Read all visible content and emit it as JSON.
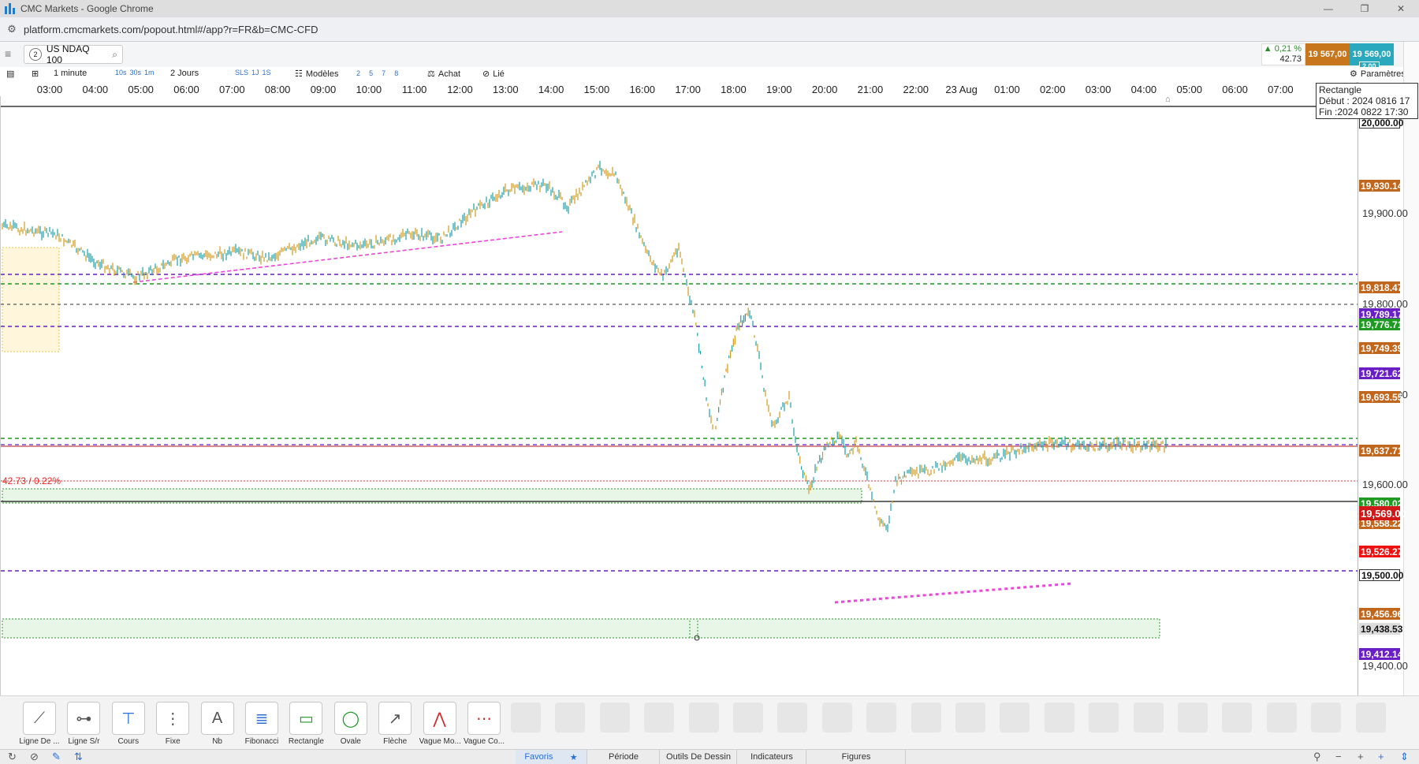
{
  "browser": {
    "window_title": "CMC Markets - Google Chrome",
    "url": "platform.cmcmarkets.com/popout.html#/app?r=FR&b=CMC-CFD",
    "controls": [
      "—",
      "❐",
      "✕"
    ]
  },
  "instrument": {
    "number": "2",
    "name": "US NDAQ 100"
  },
  "quote": {
    "change_pct": "▲ 0,21 %",
    "change_pts": "42.73",
    "bid": "19 567,00",
    "ask": "19 569,00",
    "spread": "2.00",
    "up_color": "#2a8a2a",
    "bid_color": "#c8761c",
    "ask_color": "#2aa8bd"
  },
  "toolbar": {
    "interval": "1 minute",
    "quick_intervals": [
      "10s",
      "30s",
      "1m"
    ],
    "range": "2 Jours",
    "chart_types": [
      "SLS",
      "1J",
      "1S"
    ],
    "models": "Modèles",
    "tick_modes": [
      "2",
      "5",
      "7",
      "8"
    ],
    "side": "Achat",
    "link": "Lié",
    "settings": "Paramètres"
  },
  "time_axis": [
    "03:00",
    "04:00",
    "05:00",
    "06:00",
    "07:00",
    "08:00",
    "09:00",
    "10:00",
    "11:00",
    "12:00",
    "13:00",
    "14:00",
    "15:00",
    "16:00",
    "17:00",
    "18:00",
    "19:00",
    "20:00",
    "21:00",
    "22:00",
    "23 Aug",
    "01:00",
    "02:00",
    "03:00",
    "04:00",
    "05:00",
    "06:00",
    "07:00"
  ],
  "tooltip": {
    "title": "Rectangle",
    "start": "Début : 2024 0816 17",
    "end": "Fin :2024 0822 17:30"
  },
  "price_axis": {
    "ticks": [
      "19,900.00",
      "19,800.00",
      "19,700.00",
      "19,600.00",
      "19,400.00"
    ],
    "labels": [
      {
        "text": "20,000.00",
        "bg": "#ffffff",
        "fg": "#111111"
      },
      {
        "text": "19,930.14",
        "bg": "#c0661d",
        "fg": "#ffffff"
      },
      {
        "text": "19,818.47",
        "bg": "#c0661d",
        "fg": "#ffffff"
      },
      {
        "text": "19,789.17",
        "bg": "#6a1fc6",
        "fg": "#ffffff"
      },
      {
        "text": "19,776.71",
        "bg": "#1f9a22",
        "fg": "#ffffff"
      },
      {
        "text": "19,749.39",
        "bg": "#c0661d",
        "fg": "#ffffff"
      },
      {
        "text": "19,721.62",
        "bg": "#6a1fc6",
        "fg": "#ffffff"
      },
      {
        "text": "19,693.55",
        "bg": "#c0661d",
        "fg": "#ffffff"
      },
      {
        "text": "19,637.71",
        "bg": "#c0661d",
        "fg": "#ffffff"
      },
      {
        "text": "19,580.02",
        "bg": "#1f9a22",
        "fg": "#ffffff"
      },
      {
        "text": "19,569.00",
        "bg": "#d01818",
        "fg": "#ffffff"
      },
      {
        "text": "19,558.22",
        "bg": "#c0661d",
        "fg": "#ffffff"
      },
      {
        "text": "19,526.27",
        "bg": "#ee1111",
        "fg": "#ffffff"
      },
      {
        "text": "19,500.00",
        "bg": "#ffffff",
        "fg": "#111111"
      },
      {
        "text": "19,456.96",
        "bg": "#c0661d",
        "fg": "#ffffff"
      },
      {
        "text": "19,438.53",
        "bg": "#dcdcdc",
        "fg": "#111111"
      },
      {
        "text": "19,412.14",
        "bg": "#6a1fc6",
        "fg": "#ffffff"
      }
    ]
  },
  "chart_annotation": "42.73 / 0.22%",
  "drawing_tools": [
    {
      "label": "Ligne De ...",
      "icon": "trend-line-icon"
    },
    {
      "label": "Ligne S/r",
      "icon": "horizontal-line-icon"
    },
    {
      "label": "Cours",
      "icon": "price-line-icon"
    },
    {
      "label": "Fixe",
      "icon": "vertical-line-icon"
    },
    {
      "label": "Nb",
      "icon": "text-icon"
    },
    {
      "label": "Fibonacci",
      "icon": "fibonacci-icon"
    },
    {
      "label": "Rectangle",
      "icon": "rectangle-icon"
    },
    {
      "label": "Ovale",
      "icon": "oval-icon"
    },
    {
      "label": "Flèche",
      "icon": "arrow-icon"
    },
    {
      "label": "Vague Mo...",
      "icon": "wave-icon"
    },
    {
      "label": "Vague Co...",
      "icon": "wave-correction-icon"
    }
  ],
  "bottom_tabs": [
    "Favoris",
    "Période",
    "Outils De Dessin",
    "Indicateurs",
    "Figures"
  ],
  "colors": {
    "candle_up": "#1aa0a8",
    "candle_down": "#d49a1c",
    "purple_line": "#6a1fc6",
    "green_line": "#1f9a22",
    "trend_pink": "#ee44dd"
  }
}
